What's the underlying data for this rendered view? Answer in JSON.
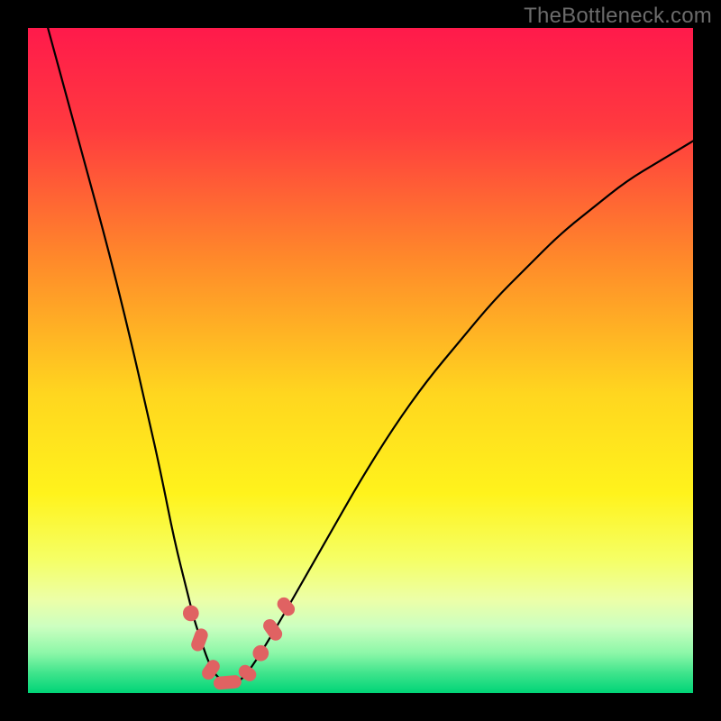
{
  "watermark": "TheBottleneck.com",
  "chart_data": {
    "type": "line",
    "title": "",
    "xlabel": "",
    "ylabel": "",
    "xlim": [
      0,
      100
    ],
    "ylim": [
      0,
      100
    ],
    "background_gradient": {
      "stops": [
        {
          "offset": 0.0,
          "color": "#ff1a4b"
        },
        {
          "offset": 0.15,
          "color": "#ff3a3f"
        },
        {
          "offset": 0.35,
          "color": "#ff8a2a"
        },
        {
          "offset": 0.55,
          "color": "#ffd61f"
        },
        {
          "offset": 0.7,
          "color": "#fff31c"
        },
        {
          "offset": 0.8,
          "color": "#f5ff66"
        },
        {
          "offset": 0.86,
          "color": "#ecffa8"
        },
        {
          "offset": 0.9,
          "color": "#ccffc0"
        },
        {
          "offset": 0.94,
          "color": "#8cf7a8"
        },
        {
          "offset": 0.97,
          "color": "#3fe48c"
        },
        {
          "offset": 1.0,
          "color": "#00d477"
        }
      ]
    },
    "series": [
      {
        "name": "curve",
        "x": [
          3,
          6,
          9,
          12,
          15,
          18,
          20,
          22,
          24,
          25,
          26,
          27,
          28,
          29,
          30,
          31,
          32,
          33,
          35,
          38,
          42,
          46,
          50,
          55,
          60,
          65,
          70,
          75,
          80,
          85,
          90,
          95,
          100
        ],
        "y": [
          100,
          89,
          78,
          67,
          55,
          42,
          33,
          23,
          15,
          11,
          8,
          5,
          3,
          2,
          1.5,
          1.5,
          2,
          3,
          6,
          11,
          18,
          25,
          32,
          40,
          47,
          53,
          59,
          64,
          69,
          73,
          77,
          80,
          83
        ]
      }
    ],
    "markers": [
      {
        "shape": "circle",
        "cx": 24.5,
        "cy": 12.0,
        "r": 1.2
      },
      {
        "shape": "capsule",
        "cx": 25.8,
        "cy": 8.0,
        "len": 3.5,
        "angle": 70
      },
      {
        "shape": "capsule",
        "cx": 27.5,
        "cy": 3.5,
        "len": 3.2,
        "angle": 55
      },
      {
        "shape": "capsule",
        "cx": 30.0,
        "cy": 1.6,
        "len": 4.2,
        "angle": 5
      },
      {
        "shape": "capsule",
        "cx": 33.0,
        "cy": 3.0,
        "len": 2.8,
        "angle": -35
      },
      {
        "shape": "circle",
        "cx": 35.0,
        "cy": 6.0,
        "r": 1.2
      },
      {
        "shape": "capsule",
        "cx": 36.8,
        "cy": 9.5,
        "len": 3.5,
        "angle": -55
      },
      {
        "shape": "capsule",
        "cx": 38.8,
        "cy": 13.0,
        "len": 3.0,
        "angle": -50
      }
    ],
    "marker_color": "#e06262",
    "curve_color": "#000000",
    "curve_width": 2.2
  }
}
